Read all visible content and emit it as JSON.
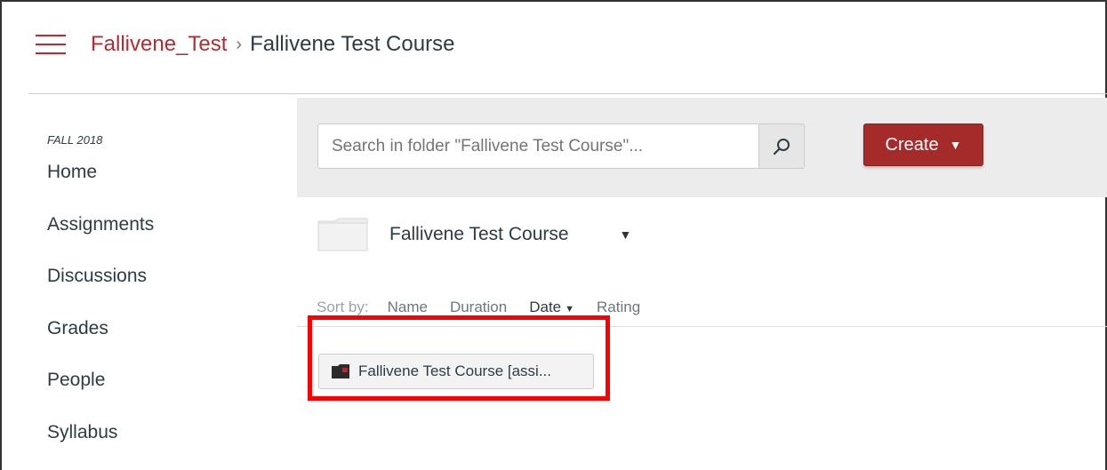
{
  "header": {
    "breadcrumb_link": "Fallivene_Test",
    "breadcrumb_separator": "›",
    "breadcrumb_current": "Fallivene Test Course"
  },
  "sidebar": {
    "term": "FALL 2018",
    "items": [
      {
        "label": "Home"
      },
      {
        "label": "Assignments"
      },
      {
        "label": "Discussions"
      },
      {
        "label": "Grades"
      },
      {
        "label": "People"
      },
      {
        "label": "Syllabus"
      }
    ]
  },
  "toolbar": {
    "search_placeholder": "Search in folder \"Fallivene Test Course\"...",
    "create_label": "Create",
    "create_caret": "▼"
  },
  "folder": {
    "name": "Fallivene Test Course",
    "caret": "▼"
  },
  "sort": {
    "label": "Sort by:",
    "options": [
      {
        "label": "Name"
      },
      {
        "label": "Duration"
      },
      {
        "label": "Date"
      },
      {
        "label": "Rating"
      }
    ],
    "active": "Date",
    "active_caret": "▼"
  },
  "items": [
    {
      "label": "Fallivene Test Course [assi..."
    }
  ],
  "colors": {
    "accent": "#b52b2f",
    "create_button": "#a52a2a",
    "highlight_box": "#ff0000"
  }
}
